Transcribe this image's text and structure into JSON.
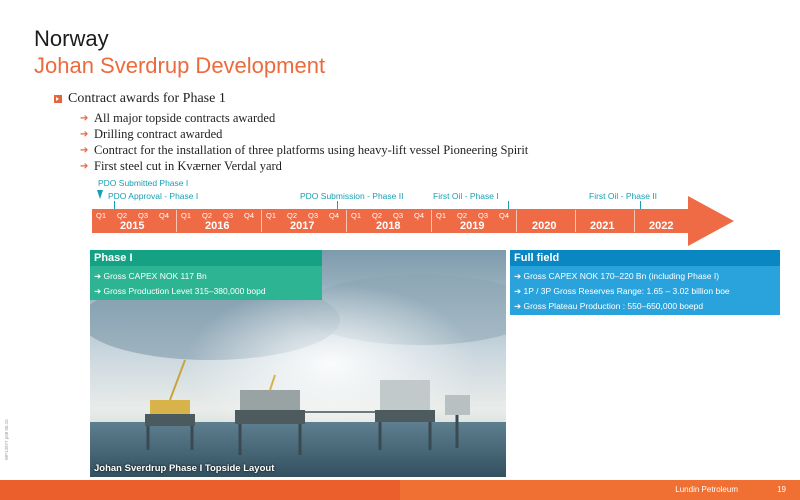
{
  "title": "Norway",
  "subtitle": "Johan Sverdrup Development",
  "main_bullet": "Contract awards for Phase 1",
  "sub_bullets": [
    "All major topside contracts awarded",
    "Drilling contract awarded",
    "Contract for the installation of three platforms using heavy-lift vessel Pioneering Spirit",
    "First steel cut in Kværner Verdal yard"
  ],
  "milestones": {
    "pdo_submitted": "PDO Submitted Phase I",
    "pdo_approval": "PDO Approval - Phase I",
    "pdo_submission_2": "PDO Submission - Phase II",
    "first_oil_1": "First Oil - Phase I",
    "first_oil_2": "First Oil - Phase II"
  },
  "quarters": [
    "Q1",
    "Q2",
    "Q3",
    "Q4"
  ],
  "years": [
    "2015",
    "2016",
    "2017",
    "2018",
    "2019",
    "2020",
    "2021",
    "2022"
  ],
  "phase1": {
    "header": "Phase I",
    "lines": [
      "Gross CAPEX NOK 117 Bn",
      "Gross Production Levet 315–380,000 bopd"
    ]
  },
  "full_field": {
    "header": "Full field",
    "lines": [
      "Gross CAPEX NOK 170–220 Bn (including Phase I)",
      "1P / 3P Gross Reserves Range: 1.65 – 3.02 billion boe",
      "Gross Plateau Production : 550–650,000 boepd"
    ]
  },
  "photo_caption": "Johan Sverdrup Phase I Topside Layout",
  "footer": {
    "company": "Lundin Petroleum",
    "page": "19"
  },
  "side_id": "WF13977 p08 08.15",
  "colors": {
    "accent": "#ec6a3c",
    "teal": "#16a0b5",
    "green": "#14a184",
    "blue": "#0a87c2"
  }
}
